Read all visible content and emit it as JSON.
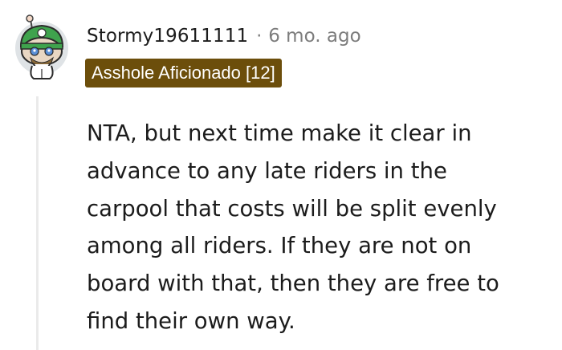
{
  "comment": {
    "author": "Stormy19611111",
    "separator": "·",
    "timestamp": "6 mo. ago",
    "flair": {
      "text": "Asshole Aficionado [12]",
      "background": "#6c4e0b",
      "color": "#ffffff"
    },
    "avatar_icon": "snoo-avatar-green-hat-icon",
    "body_lines": [
      "NTA, but next time make it clear in",
      "advance to any late riders in the",
      "carpool that costs will be split evenly",
      "among all riders. If they are not on",
      "board with that, then they are free to",
      "find their own way."
    ]
  }
}
